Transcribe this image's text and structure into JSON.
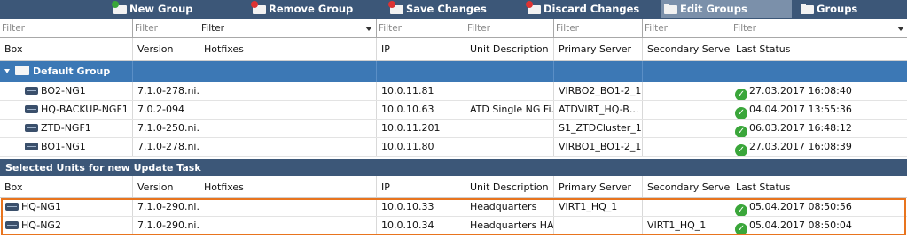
{
  "toolbar": {
    "new_group": "New Group",
    "remove_group": "Remove Group",
    "save_changes": "Save Changes",
    "discard_changes": "Discard Changes",
    "edit_groups": "Edit Groups",
    "groups": "Groups"
  },
  "filters": [
    "Filter",
    "Filter",
    "Filter",
    "Filter",
    "Filter",
    "Filter",
    "Filter",
    "Filter"
  ],
  "columns": [
    "Box",
    "Version",
    "Hotfixes",
    "IP",
    "Unit Description",
    "Primary Server",
    "Secondary Server",
    "Last Status"
  ],
  "group": {
    "name": "Default Group"
  },
  "units": [
    {
      "box": "BO2-NG1",
      "version": "7.1.0-278.ni...",
      "hotfixes": "",
      "ip": "10.0.11.81",
      "description": "",
      "primary": "VIRBO2_BO1-2_1",
      "secondary": "",
      "status": "27.03.2017 16:08:40"
    },
    {
      "box": "HQ-BACKUP-NGF1",
      "version": "7.0.2-094",
      "hotfixes": "",
      "ip": "10.0.10.63",
      "description": "ATD Single NG Fi...",
      "primary": "ATDVIRT_HQ-B...",
      "secondary": "",
      "status": "04.04.2017 13:55:36"
    },
    {
      "box": "ZTD-NGF1",
      "version": "7.1.0-250.ni...",
      "hotfixes": "",
      "ip": "10.0.11.201",
      "description": "",
      "primary": "S1_ZTDCluster_1",
      "secondary": "",
      "status": "06.03.2017 16:48:12"
    },
    {
      "box": "BO1-NG1",
      "version": "7.1.0-278.ni...",
      "hotfixes": "",
      "ip": "10.0.11.80",
      "description": "",
      "primary": "VIRBO1_BO1-2_1",
      "secondary": "",
      "status": "27.03.2017 16:08:39"
    }
  ],
  "selected_section": {
    "title": "Selected Units for new Update Task"
  },
  "selected_units": [
    {
      "box": "HQ-NG1",
      "version": "7.1.0-290.ni...",
      "hotfixes": "",
      "ip": "10.0.10.33",
      "description": "Headquarters",
      "primary": "VIRT1_HQ_1",
      "secondary": "",
      "status": "05.04.2017 08:50:56"
    },
    {
      "box": "HQ-NG2",
      "version": "7.1.0-290.ni...",
      "hotfixes": "",
      "ip": "10.0.10.34",
      "description": "Headquarters HA",
      "primary": "",
      "secondary": "VIRT1_HQ_1",
      "status": "05.04.2017 08:50:04"
    }
  ],
  "colors": {
    "toolbar_bg": "#3c5778",
    "group_bg": "#3c78b5",
    "highlight_border": "#e8741e",
    "status_ok": "#3aa63a"
  }
}
